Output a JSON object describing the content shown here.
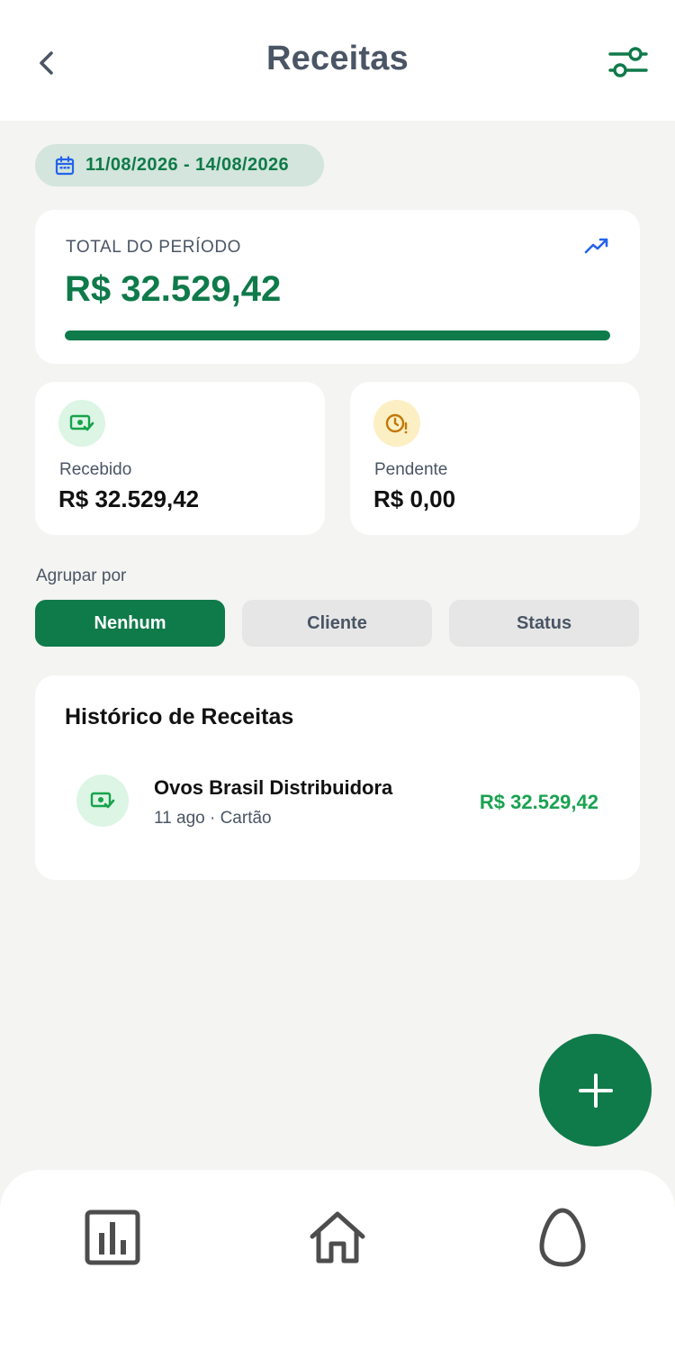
{
  "header": {
    "title": "Receitas",
    "back_icon": "chevron-left-icon",
    "filter_icon": "sliders-icon"
  },
  "date_range": {
    "label": "11/08/2026 - 14/08/2026",
    "icon": "calendar-icon"
  },
  "total": {
    "label": "TOTAL DO PERÍODO",
    "value": "R$ 32.529,42",
    "trend_icon": "trending-up-icon",
    "progress_fraction": 1.0
  },
  "received": {
    "label": "Recebido",
    "value": "R$ 32.529,42",
    "icon": "money-check-icon"
  },
  "pending": {
    "label": "Pendente",
    "value": "R$ 0,00",
    "icon": "clock-alert-icon"
  },
  "group_by": {
    "label": "Agrupar por",
    "options": [
      "Nenhum",
      "Cliente",
      "Status"
    ],
    "selected": "Nenhum"
  },
  "history": {
    "title": "Histórico de Receitas",
    "items": [
      {
        "name": "Ovos Brasil Distribuidora",
        "subtitle": "11 ago · Cartão",
        "amount": "R$ 32.529,42",
        "icon": "money-check-icon"
      }
    ]
  },
  "fab": {
    "icon": "plus-icon"
  },
  "bottom_nav": {
    "items": [
      "bar-chart-icon",
      "home-icon",
      "egg-icon"
    ]
  },
  "colors": {
    "brand_green": "#0f7a4a",
    "amount_green": "#1aa251",
    "pending_yellow": "#fcefc4",
    "text_gray": "#4a5565",
    "trend_blue": "#2563eb"
  }
}
